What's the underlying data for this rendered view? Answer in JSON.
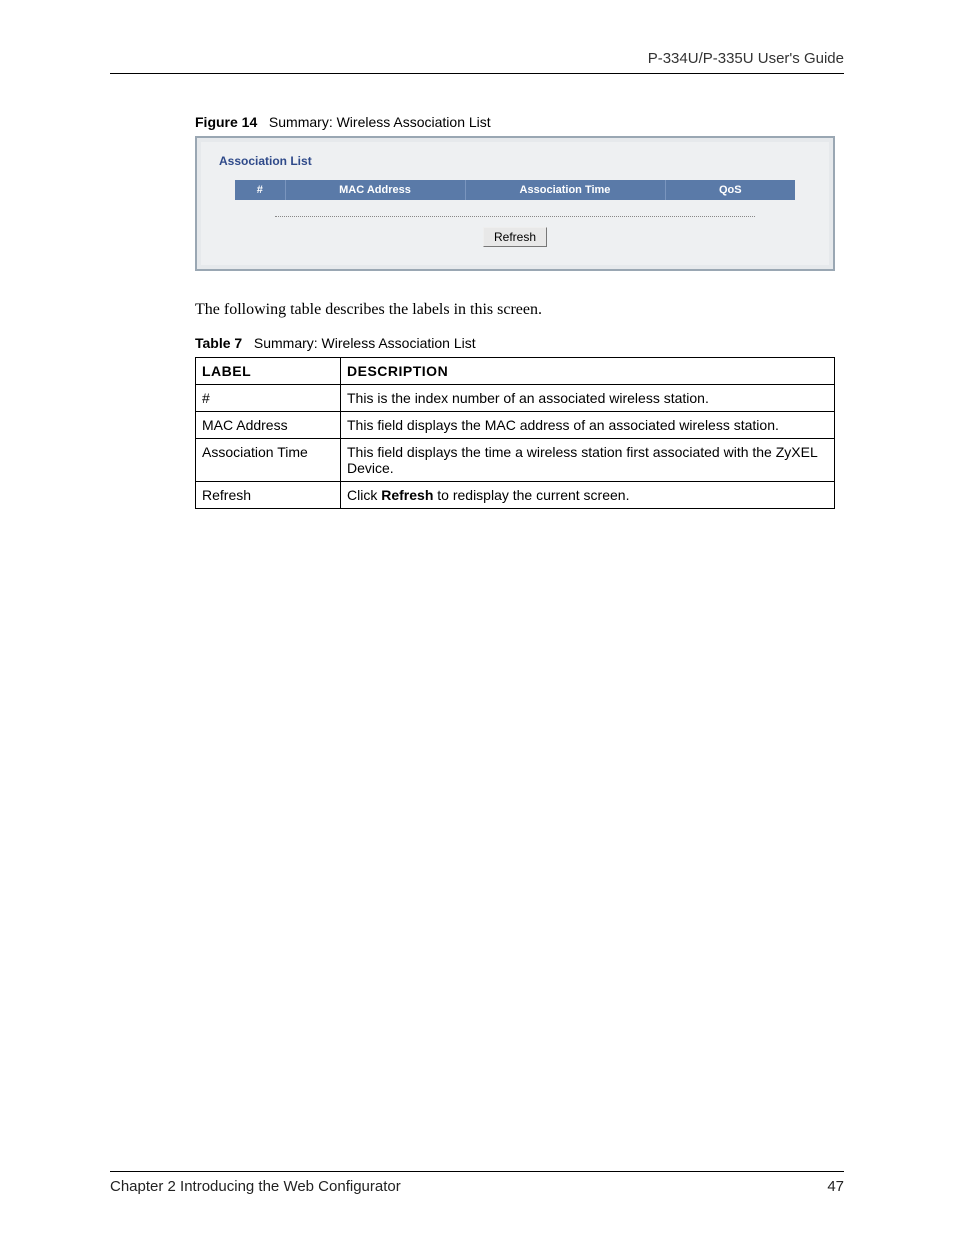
{
  "header": {
    "guide_title": "P-334U/P-335U User's Guide"
  },
  "figure": {
    "label": "Figure 14",
    "title": "Summary: Wireless Association List",
    "panel_title": "Association List",
    "columns": {
      "c1": "#",
      "c2": "MAC Address",
      "c3": "Association Time",
      "c4": "QoS"
    },
    "refresh_button": "Refresh"
  },
  "body": {
    "intro": "The following table describes the labels in this screen."
  },
  "table": {
    "label": "Table 7",
    "title": "Summary: Wireless Association List",
    "header": {
      "h1": "LABEL",
      "h2": "DESCRIPTION"
    },
    "rows": [
      {
        "label": "#",
        "desc": "This is the index number of an associated wireless station."
      },
      {
        "label": "MAC Address",
        "desc": "This field displays the MAC address of an associated wireless station."
      },
      {
        "label": "Association Time",
        "desc": "This field displays the time a wireless station first associated with the ZyXEL Device."
      },
      {
        "label": "Refresh",
        "desc_pre": "Click ",
        "desc_bold": "Refresh",
        "desc_post": " to redisplay the current screen."
      }
    ]
  },
  "footer": {
    "chapter": "Chapter 2 Introducing the Web Configurator",
    "page_number": "47"
  }
}
